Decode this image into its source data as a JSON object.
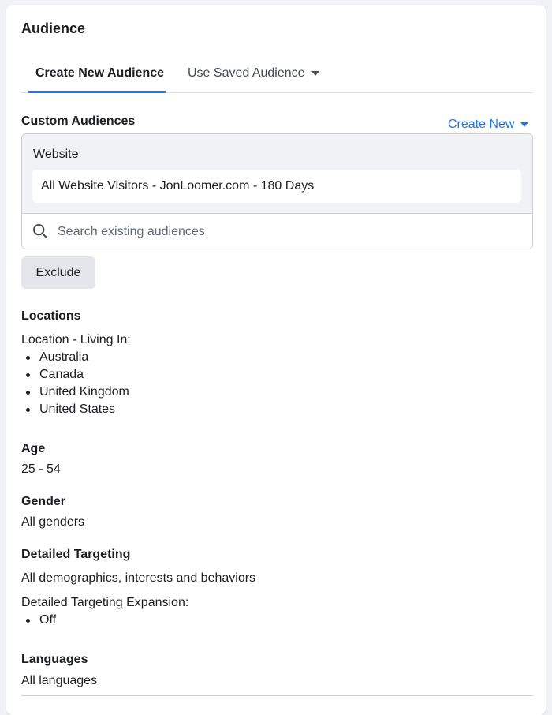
{
  "card": {
    "title": "Audience"
  },
  "tabs": [
    {
      "label": "Create New Audience",
      "active": true
    },
    {
      "label": "Use Saved Audience",
      "active": false
    }
  ],
  "custom_audiences": {
    "label": "Custom Audiences",
    "create_new_label": "Create New",
    "group_label": "Website",
    "selected": "All Website Visitors - JonLoomer.com - 180 Days",
    "search_placeholder": "Search existing audiences",
    "exclude_label": "Exclude"
  },
  "locations": {
    "label": "Locations",
    "sublabel": "Location - Living In:",
    "items": [
      "Australia",
      "Canada",
      "United Kingdom",
      "United States"
    ]
  },
  "age": {
    "label": "Age",
    "value": "25 - 54"
  },
  "gender": {
    "label": "Gender",
    "value": "All genders"
  },
  "detailed_targeting": {
    "label": "Detailed Targeting",
    "value": "All demographics, interests and behaviors",
    "expansion_label": "Detailed Targeting Expansion:",
    "expansion_items": [
      "Off"
    ]
  },
  "languages": {
    "label": "Languages",
    "value": "All languages"
  },
  "colors": {
    "accent": "#1877f2",
    "text": "#1c1e21",
    "muted": "#606770",
    "panel": "#f0f2f5"
  },
  "icons": {
    "search": "search-icon",
    "dropdown": "caret-down-icon"
  }
}
